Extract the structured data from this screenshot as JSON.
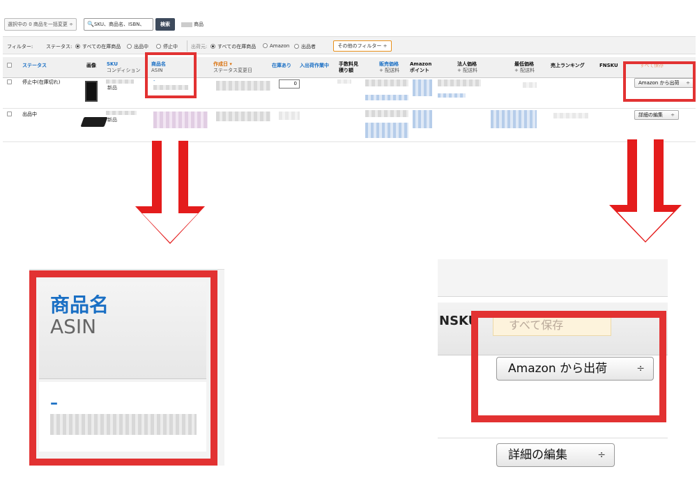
{
  "toolbar": {
    "bulk_select": "選択中の 0 商品を一括変更",
    "bulk_caret": "÷",
    "search_icon": "🔍",
    "search_placeholder": "SKU、商品名、ISBN、",
    "search_button": "検索",
    "count_suffix": "商品"
  },
  "filters": {
    "label": "フィルター:",
    "status_label": "ステータス:",
    "status_all": "すべての在庫商品",
    "status_active": "出品中",
    "status_stopped": "停止中",
    "ship_label": "出荷元:",
    "ship_all": "すべての在庫商品",
    "ship_amazon": "Amazon",
    "ship_merchant": "出品者",
    "other_filters": "その他のフィルター ÷"
  },
  "columns": {
    "status": "ステータス",
    "image": "画像",
    "sku": "SKU",
    "sku_sub": "コンディション",
    "name": "商品名",
    "name_sub": "ASIN",
    "created": "作成日 ▾",
    "created_sub": "ステータス変更日",
    "in_stock": "在庫あり",
    "inbound": "入出荷作業中",
    "fee_line1": "手数料見",
    "fee_line2": "積り額",
    "price": "販売価格",
    "price_sub": "+ 配送料",
    "amazon_line1": "Amazon",
    "amazon_line2": "ポイント",
    "business": "法人価格",
    "business_sub": "+ 配送料",
    "lowest": "最低価格",
    "lowest_sub": "+ 配送料",
    "ranking": "売上ランキング",
    "fnsku": "FNSKU",
    "save_all": "すべて保存"
  },
  "rows": [
    {
      "status": "停止中(在庫切れ)",
      "condition": "新品",
      "name_dash": "-",
      "stock": "0",
      "action": "Amazon から出荷"
    },
    {
      "status": "出品中",
      "condition": "新品",
      "action": "詳細の編集"
    }
  ],
  "zoom_left": {
    "title": "商品名",
    "subtitle": "ASIN",
    "dash": "–"
  },
  "zoom_right": {
    "fnsku_fragment": "NSKU",
    "save_all": "すべて保存",
    "action1": "Amazon から出荷",
    "action2": "詳細の編集",
    "caret": "÷"
  },
  "colors": {
    "highlight_red": "#e23232",
    "link_blue": "#1a6fc4",
    "sort_orange": "#d9700b"
  }
}
